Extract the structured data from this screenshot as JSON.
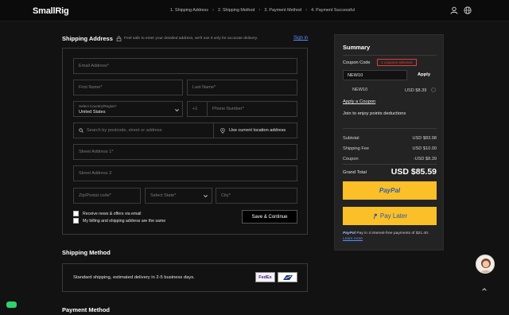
{
  "header": {
    "logo": "SmallRig",
    "steps": [
      "1. Shipping Address",
      "2. Shipping Method",
      "3. Payment Method",
      "4. Payment Successful"
    ]
  },
  "shipping_address": {
    "title": "Shipping Address",
    "note": "Feel safe to enter your detailed address, we'll use it only for accurate delivery.",
    "sign_in": "Sign in",
    "email_ph": "Email Address*",
    "first_name_ph": "First Name*",
    "last_name_ph": "Last Name*",
    "country_label": "Select Country/Region*",
    "country_value": "United States",
    "phone_code": "+1",
    "phone_ph": "Phone Number*",
    "search_ph": "Search by postcode, street or address",
    "use_location": "Use current location address",
    "street1_ph": "Street Address 1*",
    "street2_ph": "Street Address 2",
    "zip_ph": "Zip/Postal code*",
    "state_ph": "Select State*",
    "city_ph": "City*",
    "newsletter_label": "Receive news & offers via email",
    "billing_label": "My billing and shipping address are the same",
    "save_button": "Save & Continue"
  },
  "shipping_method": {
    "title": "Shipping Method",
    "text": "Standard shipping, estimated delivery in 2-5 business days.",
    "carriers": [
      "FedEx",
      "USPS"
    ]
  },
  "payment_method": {
    "title": "Payment Method"
  },
  "summary": {
    "title": "Summary",
    "coupon_label": "Coupon Code",
    "coupon_badge": "1 coupons selected",
    "coupon_input": "NEW10",
    "apply": "Apply",
    "coupon_code": "NEW10",
    "coupon_amount": "USD $8.39",
    "apply_coupon": "Apply a Coupon",
    "points": "Join to enjoy points deductions",
    "subtotal_label": "Subtotal",
    "subtotal": "USD $83.98",
    "shipping_label": "Shipping Fee",
    "shipping": "USD $10.00",
    "coupon_row_label": "Coupon",
    "coupon_row_value": "-USD $8.39",
    "total_label": "Grand Total",
    "total": "USD $85.59",
    "paypal_btn": "PayPal",
    "paylater_btn": "Pay Later",
    "paypal_note_brand": "PayPal",
    "paypal_note": "Pay in 4 interest-free payments of $21.40.",
    "learn_more": "Learn more"
  },
  "colors": {
    "accent_yellow": "#fbbf28",
    "link_blue": "#5b8cf7",
    "badge_red": "#e23b3b",
    "chat_green": "#2fd26b"
  },
  "icons": [
    "user-icon",
    "globe-icon",
    "lock-icon",
    "search-icon",
    "location-icon",
    "chevron-down-icon",
    "arrow-up-icon",
    "chat-icon"
  ]
}
